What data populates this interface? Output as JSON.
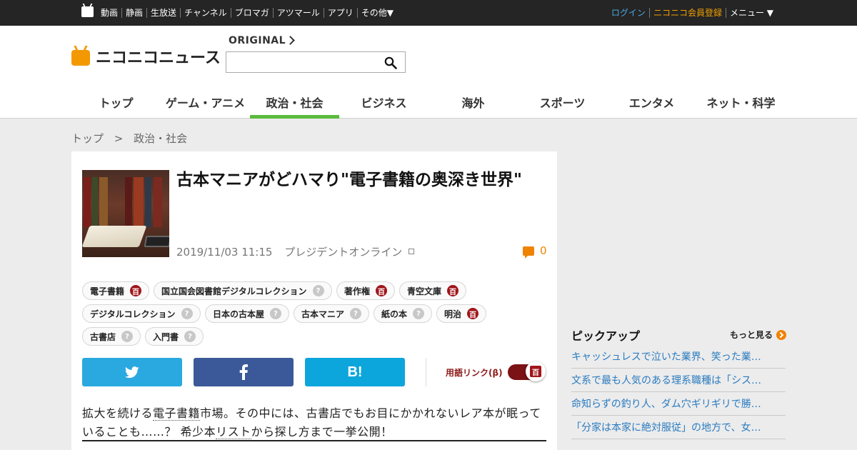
{
  "topbar": {
    "links": [
      "動画",
      "静画",
      "生放送",
      "チャンネル",
      "ブロマガ",
      "アツマール",
      "アプリ",
      "その他▼"
    ],
    "login": "ログイン",
    "register": "ニコニコ会員登録",
    "menu": "メニュー ▼"
  },
  "header": {
    "logo_text": "ニコニコニュース",
    "original_label": "ORIGINAL",
    "search_placeholder": "",
    "nav": [
      "トップ",
      "ゲーム・アニメ",
      "政治・社会",
      "ビジネス",
      "海外",
      "スポーツ",
      "エンタメ",
      "ネット・科学"
    ],
    "active_nav": "政治・社会"
  },
  "breadcrumb": [
    "トップ",
    ">",
    "政治・社会"
  ],
  "article": {
    "title": "古本マニアがどハマり\"電子書籍の奥深き世界\"",
    "datetime": "2019/11/03 11:15",
    "source": "プレジデントオンライン",
    "comment_count": "0",
    "tags": [
      {
        "label": "電子書籍",
        "badge": "百"
      },
      {
        "label": "国立国会図書館デジタルコレクション",
        "badge": "?"
      },
      {
        "label": "著作権",
        "badge": "百"
      },
      {
        "label": "青空文庫",
        "badge": "百"
      },
      {
        "label": "デジタルコレクション",
        "badge": "?"
      },
      {
        "label": "日本の古本屋",
        "badge": "?"
      },
      {
        "label": "古本マニア",
        "badge": "?"
      },
      {
        "label": "紙の本",
        "badge": "?"
      },
      {
        "label": "明治",
        "badge": "百"
      },
      {
        "label": "古書店",
        "badge": "?"
      },
      {
        "label": "入門書",
        "badge": "?"
      }
    ],
    "term_link_label": "用語リンク(β)",
    "term_badge": "百",
    "lead_parts": [
      "拡大を続ける",
      "電子書籍",
      "市場。その中には、古書店でもお目にかかれないレア本が眠っていることも……？ 希少本",
      "リスト",
      "から探し方まで一挙公開！"
    ]
  },
  "share": {
    "twitter_icon": "twitter-bird",
    "facebook_icon": "f",
    "hatena_icon": "B!"
  },
  "pickup": {
    "title": "ピックアップ",
    "more_label": "もっと見る",
    "items": [
      "キャッシュレスで泣いた業界、笑った業…",
      "文系で最も人気のある理系職種は「シス…",
      "命知らずの釣り人、ダム穴ギリギリで勝…",
      "「分家は本家に絶対服従」の地方で、女…"
    ]
  },
  "colors": {
    "accent_green": "#5aba3c",
    "brand_orange": "#f39800",
    "link_blue": "#2a7bc0",
    "dic_red": "#a0161b"
  }
}
